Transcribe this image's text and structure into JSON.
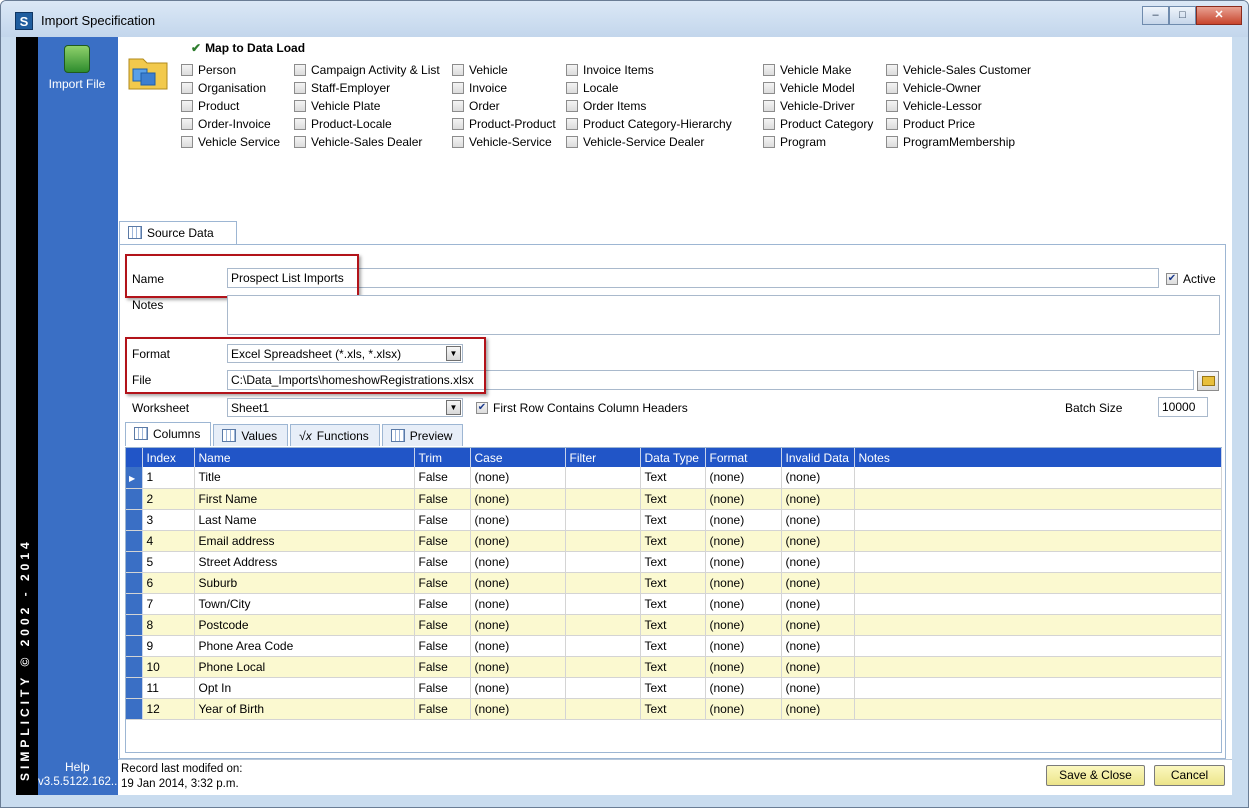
{
  "window": {
    "title": "Import Specification",
    "app_icon": "S",
    "controls": [
      "minimize-icon",
      "maximize-icon",
      "close-icon"
    ]
  },
  "sidebar": {
    "import_file_label": "Import File",
    "vertical_text": "SIMPLICITY © 2002 - 2014",
    "help_label": "Help",
    "version": "v3.5.5122.162..."
  },
  "map": {
    "title": "Map to Data Load",
    "columns": [
      [
        "Person",
        "Organisation",
        "Product",
        "Order-Invoice",
        "Vehicle Service"
      ],
      [
        "Campaign Activity & List",
        "Staff-Employer",
        "Vehicle Plate",
        "Product-Locale",
        "Vehicle-Sales Dealer"
      ],
      [
        "Vehicle",
        "Invoice",
        "Order",
        "Product-Product",
        "Vehicle-Service"
      ],
      [
        "Invoice Items",
        "Locale",
        "Order Items",
        "Product Category-Hierarchy",
        "Vehicle-Service Dealer"
      ],
      [
        "Vehicle Make",
        "Vehicle Model",
        "Vehicle-Driver",
        "Product Category",
        "Program"
      ],
      [
        "Vehicle-Sales Customer",
        "Vehicle-Owner",
        "Vehicle-Lessor",
        "Product Price",
        "ProgramMembership"
      ]
    ]
  },
  "source": {
    "tab_label": "Source Data",
    "name_label": "Name",
    "name_value": "Prospect List Imports",
    "active_label": "Active",
    "active_checked": true,
    "notes_label": "Notes",
    "notes_value": "",
    "format_label": "Format",
    "format_value": "Excel Spreadsheet (*.xls, *.xlsx)",
    "file_label": "File",
    "file_value": "C:\\Data_Imports\\homeshowRegistrations.xlsx",
    "worksheet_label": "Worksheet",
    "worksheet_value": "Sheet1",
    "first_row_label": "First Row Contains Column Headers",
    "first_row_checked": true,
    "batch_label": "Batch Size",
    "batch_value": "10000"
  },
  "tabs": [
    "Columns",
    "Values",
    "Functions",
    "Preview"
  ],
  "grid": {
    "headers": [
      "Index",
      "Name",
      "Trim",
      "Case",
      "Filter",
      "Data Type",
      "Format",
      "Invalid Data",
      "Notes"
    ],
    "rows": [
      [
        "1",
        "Title",
        "False",
        "(none)",
        "",
        "Text",
        "(none)",
        "(none)",
        ""
      ],
      [
        "2",
        "First Name",
        "False",
        "(none)",
        "",
        "Text",
        "(none)",
        "(none)",
        ""
      ],
      [
        "3",
        "Last Name",
        "False",
        "(none)",
        "",
        "Text",
        "(none)",
        "(none)",
        ""
      ],
      [
        "4",
        "Email address",
        "False",
        "(none)",
        "",
        "Text",
        "(none)",
        "(none)",
        ""
      ],
      [
        "5",
        "Street Address",
        "False",
        "(none)",
        "",
        "Text",
        "(none)",
        "(none)",
        ""
      ],
      [
        "6",
        "Suburb",
        "False",
        "(none)",
        "",
        "Text",
        "(none)",
        "(none)",
        ""
      ],
      [
        "7",
        "Town/City",
        "False",
        "(none)",
        "",
        "Text",
        "(none)",
        "(none)",
        ""
      ],
      [
        "8",
        "Postcode",
        "False",
        "(none)",
        "",
        "Text",
        "(none)",
        "(none)",
        ""
      ],
      [
        "9",
        "Phone Area Code",
        "False",
        "(none)",
        "",
        "Text",
        "(none)",
        "(none)",
        ""
      ],
      [
        "10",
        "Phone Local",
        "False",
        "(none)",
        "",
        "Text",
        "(none)",
        "(none)",
        ""
      ],
      [
        "11",
        "Opt In",
        "False",
        "(none)",
        "",
        "Text",
        "(none)",
        "(none)",
        ""
      ],
      [
        "12",
        "Year of Birth",
        "False",
        "(none)",
        "",
        "Text",
        "(none)",
        "(none)",
        ""
      ]
    ]
  },
  "status": {
    "line1": "Record last modifed on:",
    "line2": "19 Jan 2014, 3:32 p.m."
  },
  "buttons": {
    "save_close": "Save & Close",
    "cancel": "Cancel"
  },
  "colors": {
    "header_blue": "#2155c7",
    "sidebar_blue": "#3a6fc5",
    "alt_row": "#fbf9d0",
    "highlight_red": "#b2131a"
  }
}
